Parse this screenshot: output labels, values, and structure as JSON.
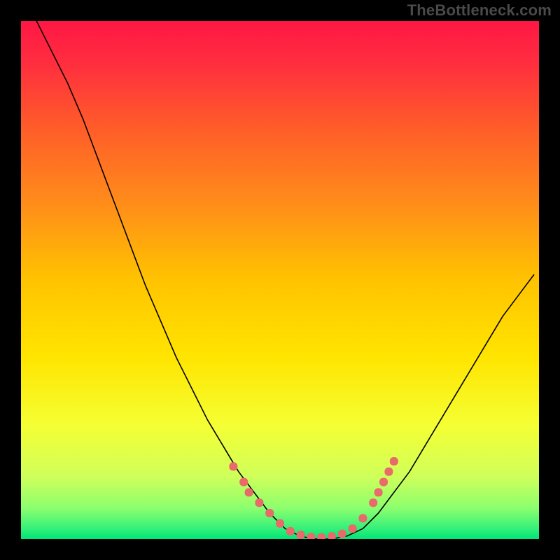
{
  "brand": {
    "label": "TheBottleneck.com"
  },
  "chart_data": {
    "type": "line",
    "title": "",
    "xlabel": "",
    "ylabel": "",
    "xlim": [
      0,
      100
    ],
    "ylim": [
      0,
      100
    ],
    "grid": false,
    "background": {
      "gradient_stops": [
        {
          "offset": 0.0,
          "color": "#ff1744"
        },
        {
          "offset": 0.08,
          "color": "#ff2d3f"
        },
        {
          "offset": 0.2,
          "color": "#ff5a2a"
        },
        {
          "offset": 0.35,
          "color": "#ff8c1a"
        },
        {
          "offset": 0.5,
          "color": "#ffc300"
        },
        {
          "offset": 0.65,
          "color": "#ffe500"
        },
        {
          "offset": 0.78,
          "color": "#f5ff33"
        },
        {
          "offset": 0.88,
          "color": "#cfff5a"
        },
        {
          "offset": 0.94,
          "color": "#8cff6e"
        },
        {
          "offset": 0.98,
          "color": "#34f07a"
        },
        {
          "offset": 1.0,
          "color": "#00e676"
        }
      ]
    },
    "series": [
      {
        "name": "bottleneck-curve",
        "stroke": "#000000",
        "stroke_width": 1.6,
        "points": [
          {
            "x": 3,
            "y": 100
          },
          {
            "x": 6,
            "y": 94
          },
          {
            "x": 9,
            "y": 88
          },
          {
            "x": 12,
            "y": 81
          },
          {
            "x": 15,
            "y": 73
          },
          {
            "x": 18,
            "y": 65
          },
          {
            "x": 21,
            "y": 57
          },
          {
            "x": 24,
            "y": 49
          },
          {
            "x": 27,
            "y": 42
          },
          {
            "x": 30,
            "y": 35
          },
          {
            "x": 33,
            "y": 29
          },
          {
            "x": 36,
            "y": 23
          },
          {
            "x": 39,
            "y": 18
          },
          {
            "x": 42,
            "y": 13
          },
          {
            "x": 45,
            "y": 9
          },
          {
            "x": 48,
            "y": 5
          },
          {
            "x": 51,
            "y": 2
          },
          {
            "x": 54,
            "y": 0.5
          },
          {
            "x": 57,
            "y": 0
          },
          {
            "x": 60,
            "y": 0
          },
          {
            "x": 63,
            "y": 0.6
          },
          {
            "x": 66,
            "y": 2
          },
          {
            "x": 69,
            "y": 5
          },
          {
            "x": 72,
            "y": 9
          },
          {
            "x": 75,
            "y": 13
          },
          {
            "x": 78,
            "y": 18
          },
          {
            "x": 81,
            "y": 23
          },
          {
            "x": 84,
            "y": 28
          },
          {
            "x": 87,
            "y": 33
          },
          {
            "x": 90,
            "y": 38
          },
          {
            "x": 93,
            "y": 43
          },
          {
            "x": 96,
            "y": 47
          },
          {
            "x": 99,
            "y": 51
          }
        ]
      }
    ],
    "marker_groups": [
      {
        "name": "trough-markers",
        "shape": "rounded",
        "color": "#e86a6a",
        "size": 12,
        "points": [
          {
            "x": 41,
            "y": 14
          },
          {
            "x": 43,
            "y": 11
          },
          {
            "x": 44,
            "y": 9
          },
          {
            "x": 46,
            "y": 7
          },
          {
            "x": 48,
            "y": 5
          },
          {
            "x": 50,
            "y": 3
          },
          {
            "x": 52,
            "y": 1.5
          },
          {
            "x": 54,
            "y": 0.8
          },
          {
            "x": 56,
            "y": 0.4
          },
          {
            "x": 58,
            "y": 0.3
          },
          {
            "x": 60,
            "y": 0.5
          },
          {
            "x": 62,
            "y": 1
          },
          {
            "x": 64,
            "y": 2
          },
          {
            "x": 66,
            "y": 4
          },
          {
            "x": 68,
            "y": 7
          },
          {
            "x": 69,
            "y": 9
          },
          {
            "x": 70,
            "y": 11
          },
          {
            "x": 71,
            "y": 13
          },
          {
            "x": 72,
            "y": 15
          }
        ]
      }
    ]
  }
}
